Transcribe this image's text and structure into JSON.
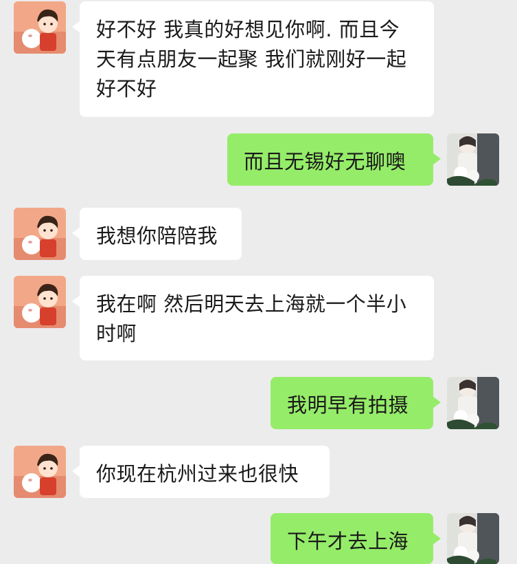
{
  "colors": {
    "background": "#ececec",
    "incoming_bubble": "#ffffff",
    "outgoing_bubble": "#95ec69",
    "text": "#1a1a1a"
  },
  "messages": [
    {
      "side": "left",
      "avatar": "cartoon-avatar-icon",
      "text": "好不好 我真的好想见你啊. 而且今天有点朋友一起聚 我们就刚好一起好不好"
    },
    {
      "side": "right",
      "avatar": "photo-avatar-icon",
      "text": "而且无锡好无聊噢"
    },
    {
      "side": "left",
      "avatar": "cartoon-avatar-icon",
      "text": "我想你陪陪我"
    },
    {
      "side": "left",
      "avatar": "cartoon-avatar-icon",
      "text": "我在啊 然后明天去上海就一个半小时啊"
    },
    {
      "side": "right",
      "avatar": "photo-avatar-icon",
      "text": "我明早有拍摄"
    },
    {
      "side": "left",
      "avatar": "cartoon-avatar-icon",
      "text": "你现在杭州过来也很快"
    },
    {
      "side": "right",
      "avatar": "photo-avatar-icon",
      "text": "下午才去上海"
    }
  ]
}
